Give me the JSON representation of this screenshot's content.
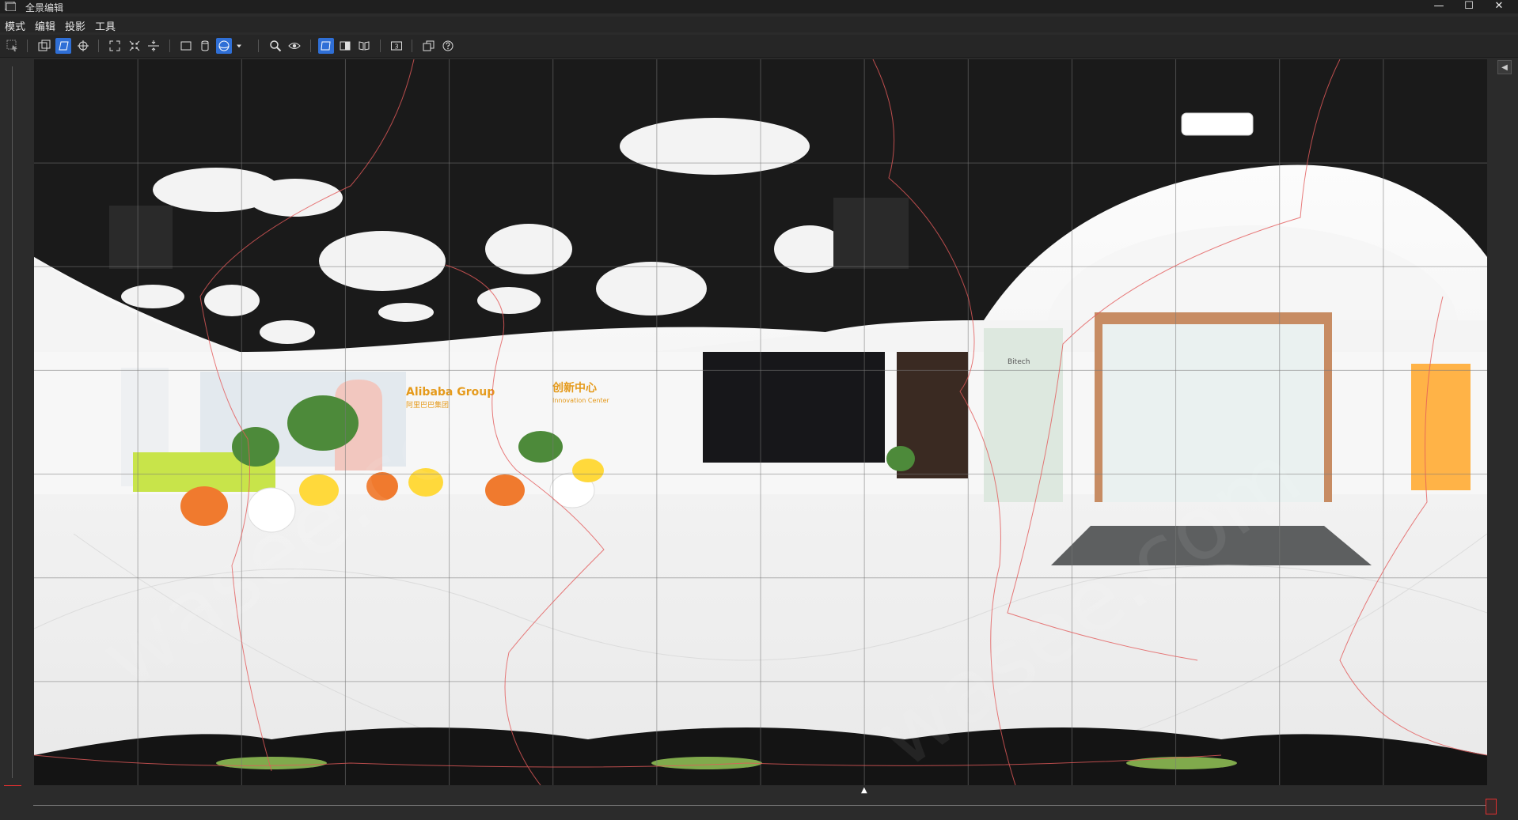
{
  "window": {
    "title": "全景编辑",
    "controls": {
      "minimize": "—",
      "maximize": "☐",
      "close": "✕"
    }
  },
  "menu": {
    "items": [
      "模式",
      "编辑",
      "投影",
      "工具"
    ]
  },
  "toolbar": {
    "groups": [
      [
        "select-tool"
      ],
      [
        "rotate-image",
        "straighten",
        "crosshair"
      ],
      [
        "fit-to-window",
        "fill-window",
        "align-horizon"
      ],
      [
        "rectilinear-projection",
        "cylindrical-projection",
        "spherical-projection",
        "projection-dropdown"
      ],
      [
        "zoom",
        "preview-eye"
      ],
      [
        "view-single",
        "view-split",
        "view-compare"
      ],
      [
        "3d-view"
      ],
      [
        "multi-window",
        "help"
      ]
    ],
    "active": [
      "straighten",
      "spherical-projection",
      "view-single"
    ],
    "badge_3d": "3"
  },
  "panorama": {
    "brand_text": "Alibaba Group",
    "brand_cn": "阿里巴巴集团",
    "center_text": "创新中心",
    "center_sub": "Innovation Center",
    "side_sign": "Bitech",
    "watermark": "wasee.com",
    "grid_columns": 14,
    "grid_rows": 7
  },
  "colors": {
    "accent": "#2f6fd6",
    "marker": "#e03030",
    "seam": "#e35a5a",
    "ceiling": "#1a1a1a",
    "floor": "#f2f2f2"
  }
}
